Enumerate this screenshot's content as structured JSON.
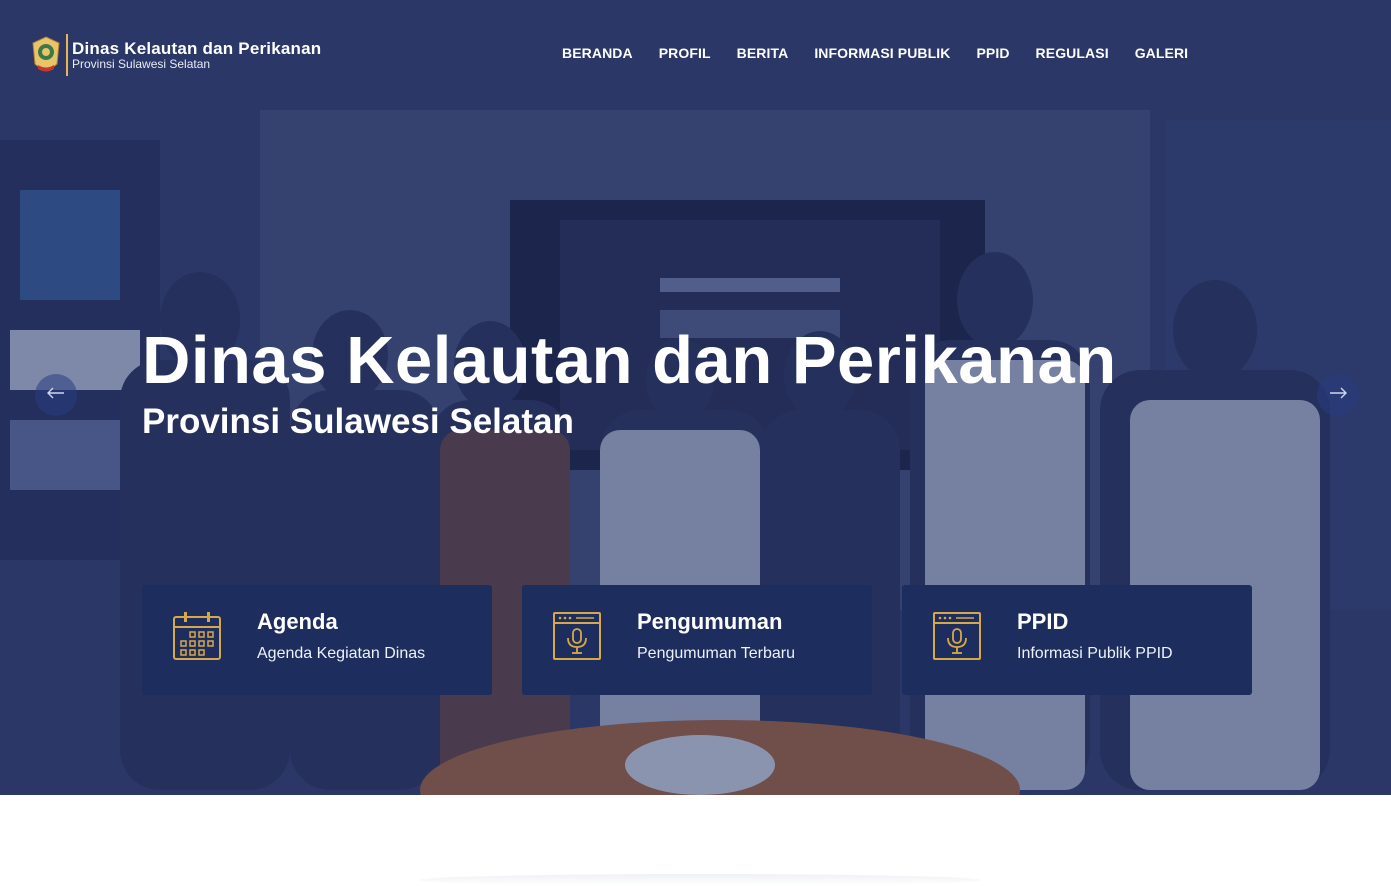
{
  "brand": {
    "title": "Dinas Kelautan dan Perikanan",
    "subtitle": "Provinsi Sulawesi Selatan",
    "emblem_icon": "provincial-emblem-icon"
  },
  "nav": {
    "items": [
      {
        "label": "BERANDA"
      },
      {
        "label": "PROFIL"
      },
      {
        "label": "BERITA"
      },
      {
        "label": "INFORMASI PUBLIK"
      },
      {
        "label": "PPID"
      },
      {
        "label": "REGULASI"
      },
      {
        "label": "GALERI"
      }
    ]
  },
  "hero": {
    "title": "Dinas Kelautan dan Perikanan",
    "subtitle": "Provinsi Sulawesi Selatan",
    "prev_icon": "arrow-left-icon",
    "next_icon": "arrow-right-icon"
  },
  "cards": [
    {
      "title": "Agenda",
      "description": "Agenda Kegiatan Dinas",
      "icon": "calendar-icon"
    },
    {
      "title": "Pengumuman",
      "description": "Pengumuman Terbaru",
      "icon": "microphone-window-icon"
    },
    {
      "title": "PPID",
      "description": "Informasi Publik PPID",
      "icon": "microphone-window-icon"
    }
  ],
  "colors": {
    "navy": "#1c2d5e",
    "accent_gold": "#d6a84a",
    "text_white": "#ffffff"
  }
}
